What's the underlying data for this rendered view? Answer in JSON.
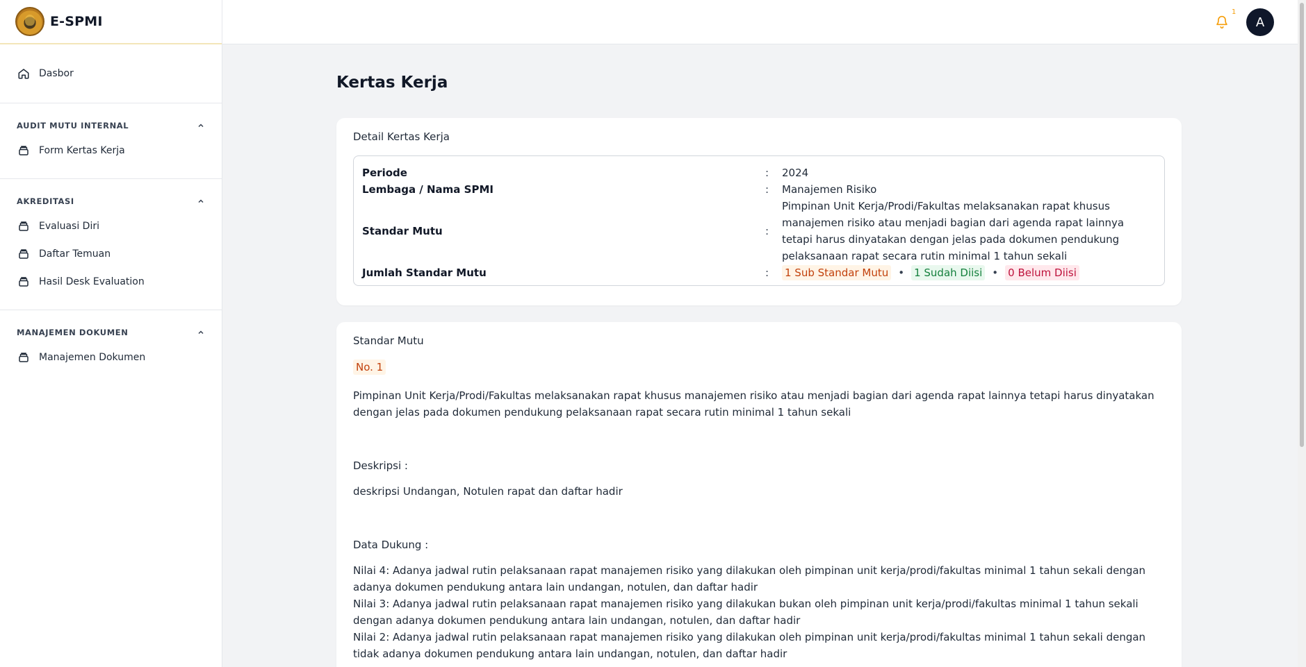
{
  "app": {
    "name": "E-SPMI"
  },
  "sidebar": {
    "dashboard": {
      "label": "Dasbor",
      "icon": "home-icon"
    },
    "sections": [
      {
        "title": "AUDIT MUTU INTERNAL",
        "items": [
          {
            "label": "Form Kertas Kerja",
            "icon": "stack-icon"
          }
        ]
      },
      {
        "title": "AKREDITASI",
        "items": [
          {
            "label": "Evaluasi Diri",
            "icon": "stack-icon"
          },
          {
            "label": "Daftar Temuan",
            "icon": "stack-icon"
          },
          {
            "label": "Hasil Desk Evaluation",
            "icon": "stack-icon"
          }
        ]
      },
      {
        "title": "MANAJEMEN DOKUMEN",
        "items": [
          {
            "label": "Manajemen Dokumen",
            "icon": "stack-icon"
          }
        ]
      }
    ]
  },
  "topbar": {
    "notification_count": "1",
    "avatar_initial": "A",
    "bell_color": "#f59e0b"
  },
  "page": {
    "title": "Kertas Kerja"
  },
  "detail": {
    "title": "Detail Kertas Kerja",
    "separator": ":",
    "rows": [
      {
        "label": "Periode",
        "value": "2024"
      },
      {
        "label": "Lembaga / Nama SPMI",
        "value": "Manajemen Risiko"
      },
      {
        "label": "Standar Mutu",
        "value": "Pimpinan Unit Kerja/Prodi/Fakultas melaksanakan rapat khusus manajemen risiko atau menjadi bagian dari agenda rapat lainnya tetapi harus dinyatakan dengan jelas pada dokumen pendukung pelaksanaan rapat secara rutin minimal 1 tahun sekali"
      },
      {
        "label": "Jumlah Standar Mutu"
      }
    ],
    "counts": {
      "sub": "1 Sub Standar Mutu",
      "filled": "1 Sudah Diisi",
      "empty": "0 Belum Diisi",
      "bullet": "•"
    }
  },
  "standard": {
    "title": "Standar Mutu",
    "number": "No. 1",
    "text": "Pimpinan Unit Kerja/Prodi/Fakultas melaksanakan rapat khusus manajemen risiko atau menjadi bagian dari agenda rapat lainnya tetapi harus dinyatakan dengan jelas pada dokumen pendukung pelaksanaan rapat secara rutin minimal 1 tahun sekali",
    "description_label": "Deskripsi :",
    "description": "deskripsi Undangan, Notulen rapat dan daftar hadir",
    "support_label": "Data Dukung :",
    "support": [
      "Nilai 4: Adanya jadwal rutin pelaksanaan rapat manajemen risiko yang dilakukan oleh pimpinan unit kerja/prodi/fakultas minimal 1 tahun sekali dengan adanya dokumen pendukung antara lain undangan, notulen, dan daftar hadir",
      "Nilai 3: Adanya jadwal rutin pelaksanaan rapat manajemen risiko yang dilakukan bukan oleh pimpinan unit kerja/prodi/fakultas minimal 1 tahun sekali dengan adanya dokumen pendukung antara lain undangan, notulen, dan daftar hadir",
      "Nilai 2: Adanya jadwal rutin pelaksanaan rapat manajemen risiko yang dilakukan oleh pimpinan unit kerja/prodi/fakultas minimal 1 tahun sekali dengan tidak adanya dokumen pendukung antara lain undangan, notulen, dan daftar hadir"
    ]
  }
}
